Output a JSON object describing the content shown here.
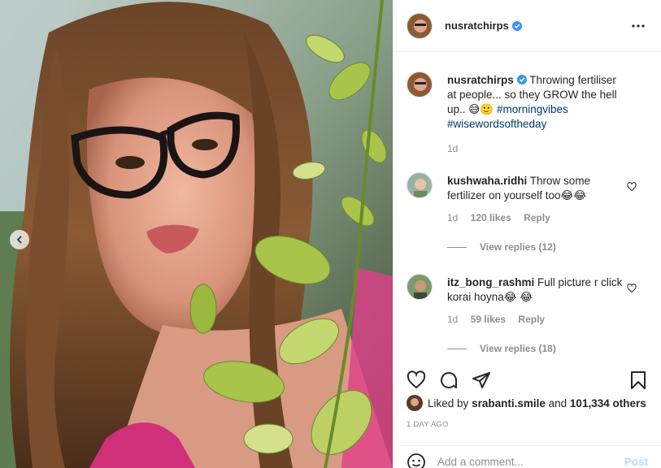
{
  "post": {
    "username": "nusratchirps",
    "verified": true
  },
  "caption": {
    "username": "nusratchirps",
    "text": "Throwing fertiliser at people... so they GROW the hell up..",
    "emojis": "😅🙂",
    "hashtag1": "#morningvibes",
    "hashtag2": "#wisewordsoftheday",
    "age": "1d"
  },
  "comments": [
    {
      "username": "kushwaha.ridhi",
      "text": "Throw some fertilizer on yourself too😂😂",
      "age": "1d",
      "likes": "120 likes",
      "reply": "Reply",
      "view_replies": "View replies (12)"
    },
    {
      "username": "itz_bong_rashmi",
      "text": "Full picture r click korai hoyna😂 😂",
      "age": "1d",
      "likes": "59 likes",
      "reply": "Reply",
      "view_replies": "View replies (18)"
    }
  ],
  "likes": {
    "prefix": "Liked by",
    "user": "srabanti.smile",
    "joiner": "and",
    "others": "101,334 others"
  },
  "timestamp": "1 DAY AGO",
  "add_comment": {
    "placeholder": "Add a comment...",
    "post_label": "Post"
  },
  "icons": {
    "more": "more-options-icon",
    "heart": "heart-icon",
    "comment": "comment-icon",
    "share": "share-icon",
    "save": "bookmark-icon",
    "emoji": "emoji-icon",
    "prev": "chevron-left-icon"
  },
  "colors": {
    "verified": "#3897f0",
    "hashtag": "#00376b",
    "muted": "#8e8e8e",
    "post_disabled": "#b2dffc"
  }
}
